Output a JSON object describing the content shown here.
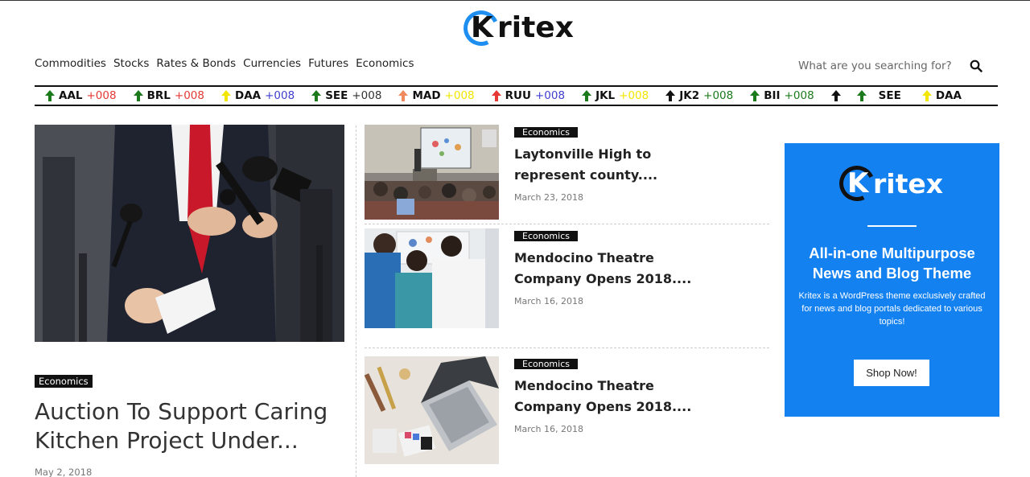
{
  "brand": {
    "name": "ritex",
    "mark_letter": "K"
  },
  "nav": {
    "items": [
      "Commodities",
      "Stocks",
      "Rates & Bonds",
      "Currencies",
      "Futures",
      "Economics"
    ]
  },
  "search": {
    "placeholder": "What are you searching for?"
  },
  "ticker": [
    {
      "symbol": "AAL",
      "value": "+008",
      "value_color": "#e53935",
      "arrow": "up",
      "arrow_color": "#1b7a1b"
    },
    {
      "symbol": "BRL",
      "value": "+008",
      "value_color": "#e53935",
      "arrow": "up",
      "arrow_color": "#1b7a1b"
    },
    {
      "symbol": "DAA",
      "value": "+008",
      "value_color": "#3f3fcf",
      "arrow": "up",
      "arrow_color": "#f2e600"
    },
    {
      "symbol": "SEE",
      "value": "+008",
      "value_color": "#333333",
      "arrow": "up",
      "arrow_color": "#1b7a1b"
    },
    {
      "symbol": "MAD",
      "value": "+008",
      "value_color": "#f2e600",
      "arrow": "up",
      "arrow_color": "#f08a5d"
    },
    {
      "symbol": "RUU",
      "value": "+008",
      "value_color": "#3f3fcf",
      "arrow": "up",
      "arrow_color": "#e53935"
    },
    {
      "symbol": "JKL",
      "value": "+008",
      "value_color": "#f2e600",
      "arrow": "up",
      "arrow_color": "#1b7a1b"
    },
    {
      "symbol": "JK2",
      "value": "+008",
      "value_color": "#1b7a1b",
      "arrow": "up",
      "arrow_color": "#111111"
    },
    {
      "symbol": "BII",
      "value": "+008",
      "value_color": "#1b7a1b",
      "arrow": "up",
      "arrow_color": "#1b7a1b"
    },
    {
      "symbol": "SEE",
      "value": "",
      "value_color": "#333333",
      "arrow": "up",
      "arrow_color": "#111111",
      "extra_arrow_color": "#1b7a1b"
    },
    {
      "symbol": "DAA",
      "value": "",
      "value_color": "#333333",
      "arrow": "up",
      "arrow_color": "#f2e600"
    }
  ],
  "feature": {
    "category": "Economics",
    "title": "Auction To Support Caring Kitchen Project Under...",
    "date": "May 2, 2018"
  },
  "articles": [
    {
      "category": "Economics",
      "title": "Laytonville High to represent county....",
      "date": "March 23, 2018"
    },
    {
      "category": "Economics",
      "title": "Mendocino Theatre Company Opens 2018....",
      "date": "March 16, 2018"
    },
    {
      "category": "Economics",
      "title": "Mendocino Theatre Company Opens 2018....",
      "date": "March 16, 2018"
    }
  ],
  "ad": {
    "brand": "ritex",
    "mark_letter": "K",
    "headline": "All-in-one Multipurpose News and Blog Theme",
    "body": "Kritex is a WordPress theme exclusively crafted for news and blog portals dedicated to various topics!",
    "button": "Shop Now!",
    "bg_color": "#1481f0"
  },
  "colors": {
    "accent": "#1e8ef0",
    "text": "#222222"
  }
}
